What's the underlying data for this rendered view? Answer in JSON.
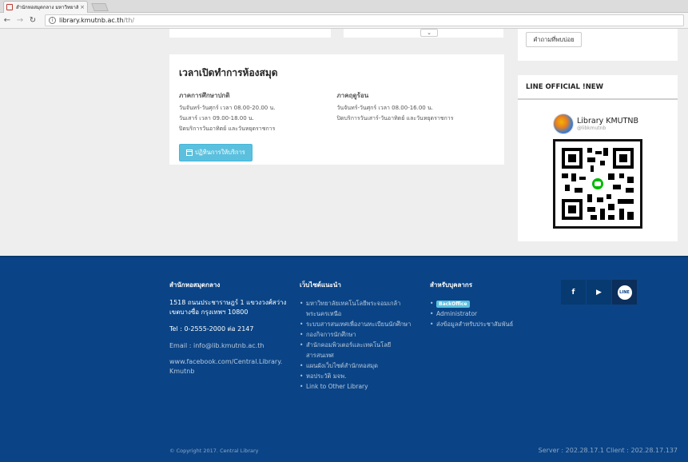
{
  "browser": {
    "tab_title": "สำนักหอสมุดกลาง มหาวิทยาลัย",
    "tab_close": "×",
    "url_host": "library.kmutnb.ac.th",
    "url_path": "/th/"
  },
  "faq_button": "คำถามที่พบบ่อย",
  "hours": {
    "title": "เวลาเปิดทำการห้องสมุด",
    "regular": {
      "heading": "ภาคการศึกษาปกติ",
      "lines": [
        "วันจันทร์-วันศุกร์ เวลา 08.00-20.00 น.",
        "วันเสาร์ เวลา 09.00-18.00 น.",
        "ปิดบริการวันอาทิตย์ และวันหยุดราชการ"
      ]
    },
    "summer": {
      "heading": "ภาคฤดูร้อน",
      "lines": [
        "วันจันทร์-วันศุกร์ เวลา 08.00-16.00 น.",
        "ปิดบริการวันเสาร์-วันอาทิตย์ และวันหยุดราชการ"
      ]
    },
    "calendar_button": "ปฏิทินการให้บริการ"
  },
  "line_official": {
    "title": "LINE OFFICIAL !NEW",
    "name": "Library KMUTNB",
    "handle": "@libkmutnb"
  },
  "footer": {
    "col1": {
      "heading": "สำนักหอสมุดกลาง",
      "address": "1518 ถนนประชาราษฎร์ 1 แขวงวงศ์สว่าง เขตบางซื่อ กรุงเทพฯ 10800",
      "tel": "Tel : 0-2555-2000 ต่อ 2147",
      "email": "Email : info@lib.kmutnb.ac.th",
      "facebook": "www.facebook.com/Central.Library.Kmutnb"
    },
    "col2": {
      "heading": "เว็บไซต์แนะนำ",
      "links": [
        "มหาวิทยาลัยเทคโนโลยีพระจอมเกล้าพระนครเหนือ",
        "ระบบสารสนเทศเพื่องานทะเบียนนักศึกษา",
        "กองกิจการนักศึกษา",
        "สำนักคอมพิวเตอร์และเทคโนโลยีสารสนเทศ",
        "แผนผังเว็บไซต์สำนักหอสมุด",
        "หอประวัติ มจพ.",
        "Link to Other Library"
      ]
    },
    "col3": {
      "heading": "สำหรับบุคลากร",
      "backoffice": "BackOffice",
      "links": [
        "Administrator",
        "ส่งข้อมูลสำหรับประชาสัมพันธ์"
      ]
    },
    "social": {
      "facebook": "f",
      "youtube": "▶",
      "line": "LINE"
    },
    "copyright": "© Copyright 2017. Central Library",
    "server": "Server : 202.28.17.1 Client : 202.28.17.137"
  }
}
